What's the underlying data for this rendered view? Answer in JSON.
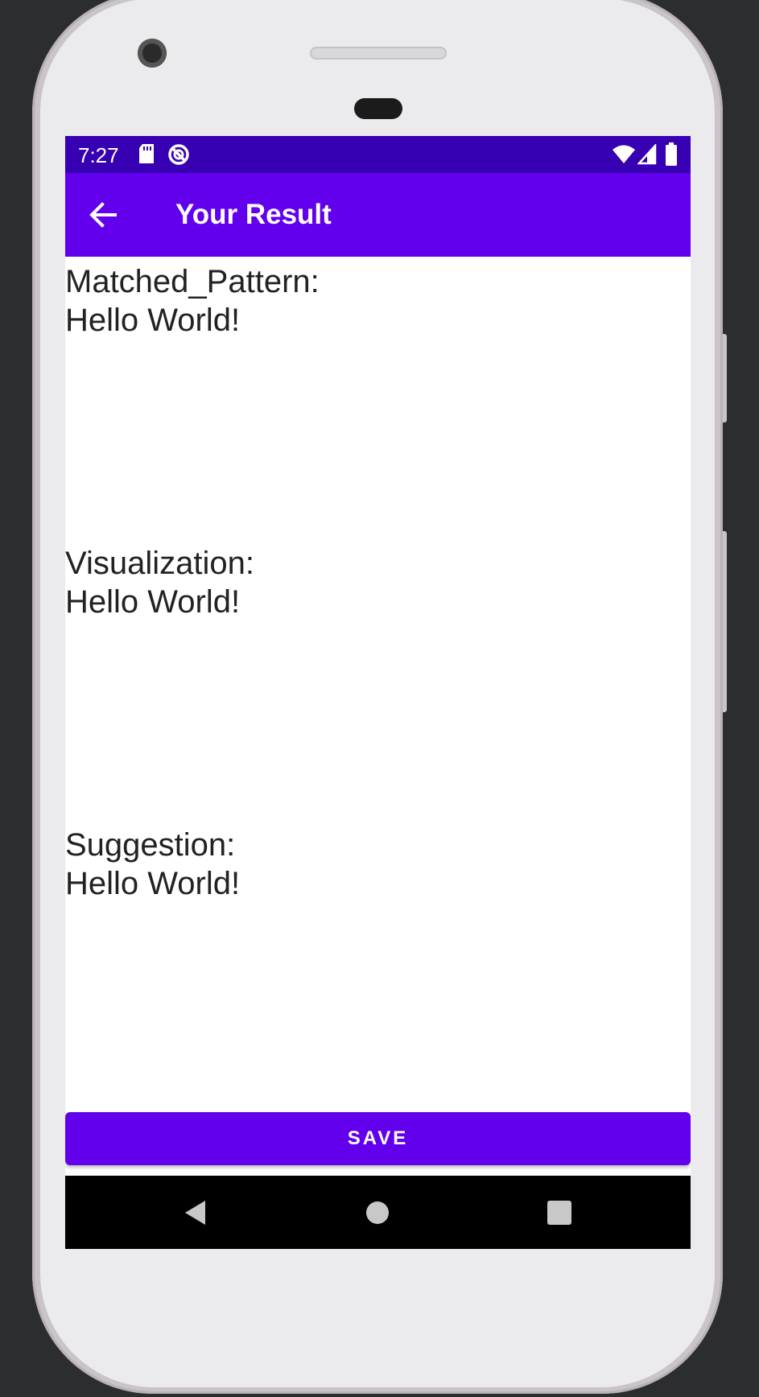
{
  "status_bar": {
    "time": "7:27",
    "icons": [
      "sd-card-icon",
      "no-disturb-icon",
      "wifi-icon",
      "signal-icon",
      "battery-icon"
    ]
  },
  "app_bar": {
    "title": "Your Result",
    "back_icon": "arrow-left-icon"
  },
  "sections": [
    {
      "label": "Matched_Pattern:",
      "value": "Hello World!"
    },
    {
      "label": "Visualization:",
      "value": "Hello World!"
    },
    {
      "label": "Suggestion:",
      "value": "Hello World!"
    }
  ],
  "save_button": {
    "label": "SAVE"
  },
  "nav_bar": {
    "back": "triangle-back-icon",
    "home": "circle-home-icon",
    "recents": "square-recents-icon"
  },
  "colors": {
    "status_bar": "#3700b3",
    "primary": "#6200ee",
    "text": "#222222"
  }
}
